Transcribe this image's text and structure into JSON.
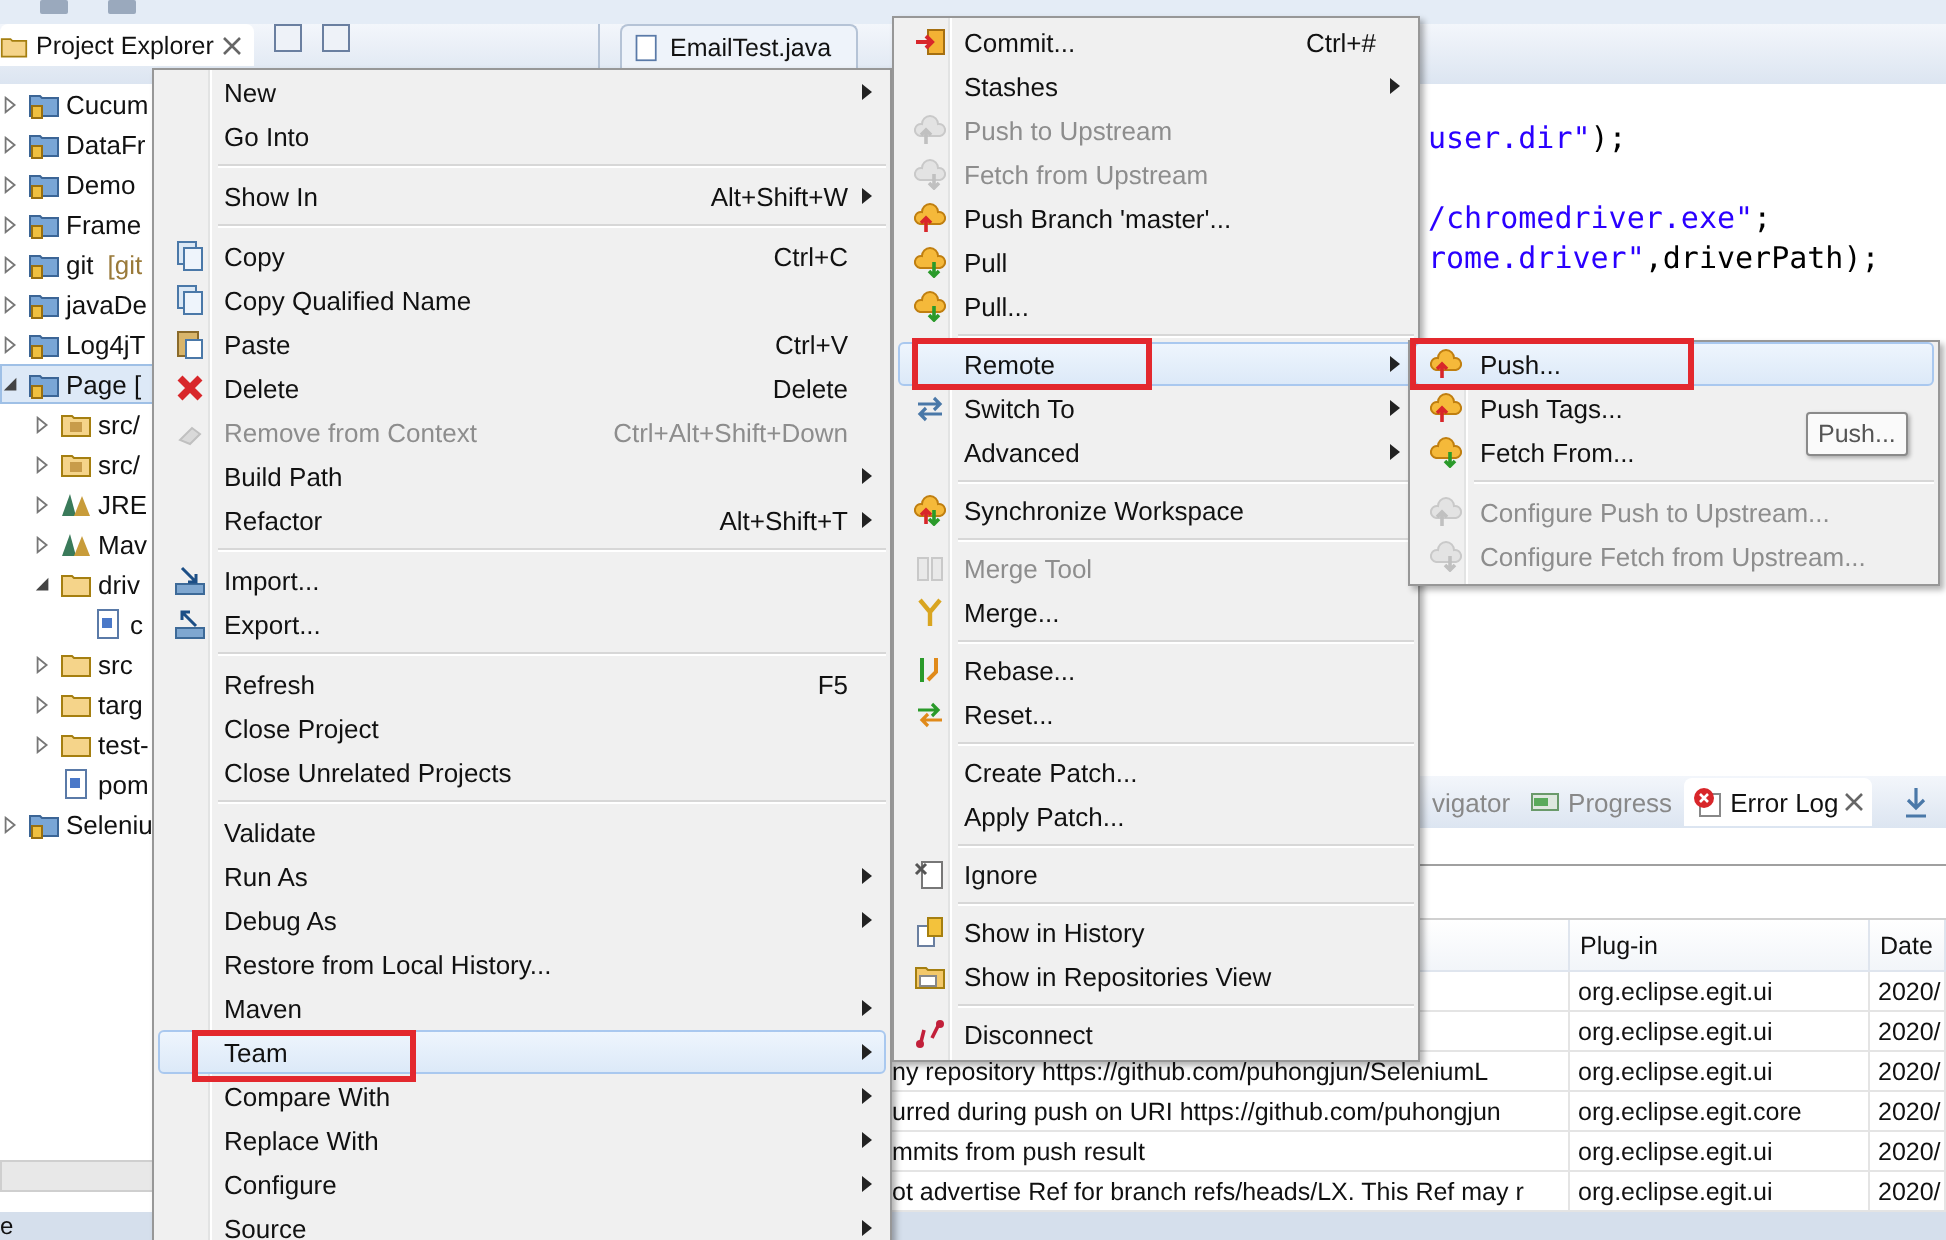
{
  "project_explorer": {
    "title": "Project Explorer",
    "tree": [
      {
        "label": "Cucum",
        "kind": "project",
        "expanded": false,
        "selected": false
      },
      {
        "label": "DataFr",
        "kind": "project",
        "expanded": false,
        "selected": false
      },
      {
        "label": "Demo",
        "kind": "project",
        "expanded": false,
        "selected": false
      },
      {
        "label": "Frame",
        "kind": "project",
        "expanded": false,
        "selected": false
      },
      {
        "label": "git",
        "decoration": "[git",
        "kind": "project",
        "expanded": false,
        "selected": false
      },
      {
        "label": "javaDe",
        "kind": "project",
        "expanded": false,
        "selected": false
      },
      {
        "label": "Log4jT",
        "kind": "project",
        "expanded": false,
        "selected": false
      },
      {
        "label": "Page [",
        "kind": "project",
        "expanded": true,
        "selected": true,
        "children": [
          {
            "label": "src/",
            "kind": "package",
            "expanded": false,
            "selected": false
          },
          {
            "label": "src/",
            "kind": "package",
            "expanded": false,
            "selected": false
          },
          {
            "label": "JRE",
            "kind": "library",
            "expanded": false,
            "selected": false
          },
          {
            "label": "Mav",
            "kind": "library",
            "expanded": false,
            "selected": false
          },
          {
            "label": "driv",
            "kind": "folder",
            "expanded": true,
            "selected": false,
            "children": [
              {
                "label": "c",
                "kind": "file",
                "selected": false
              }
            ]
          },
          {
            "label": "src",
            "kind": "folder",
            "expanded": false,
            "selected": false
          },
          {
            "label": "targ",
            "kind": "folder",
            "expanded": false,
            "selected": false
          },
          {
            "label": "test-",
            "kind": "folder",
            "expanded": false,
            "selected": false
          },
          {
            "label": "pom",
            "kind": "file",
            "selected": false
          }
        ]
      },
      {
        "label": "Seleniu",
        "kind": "project",
        "expanded": false,
        "selected": false
      }
    ]
  },
  "editor": {
    "tab": "EmailTest.java",
    "lines": [
      [
        {
          "text": "user.dir\"",
          "kind": "string"
        },
        {
          "text": ");",
          "kind": "plain"
        }
      ],
      [
        {
          "text": "/chromedriver.exe\"",
          "kind": "string"
        },
        {
          "text": ";",
          "kind": "plain"
        }
      ],
      [
        {
          "text": "rome.driver\"",
          "kind": "string"
        },
        {
          "text": ",driverPath);",
          "kind": "plain"
        }
      ]
    ]
  },
  "bottom_panel": {
    "tabs": [
      {
        "label": "vigator",
        "kind": "plain",
        "selected": false
      },
      {
        "label": "Progress",
        "kind": "progress",
        "selected": false
      },
      {
        "label": "Error Log",
        "kind": "error",
        "selected": true
      }
    ],
    "columns": [
      "Plug-in",
      "Date"
    ],
    "rows": [
      {
        "plug_in": "org.eclipse.egit.ui",
        "date": "2020/"
      },
      {
        "plug_in": "org.eclipse.egit.ui",
        "date": "2020/"
      },
      {
        "column_1": "ny repository https://github.com/puhongjun/SeleniumL",
        "plug_in": "org.eclipse.egit.ui",
        "date": "2020/"
      },
      {
        "column_1": "urred during push on URI https://github.com/puhongjun",
        "plug_in": "org.eclipse.egit.core",
        "date": "2020/"
      },
      {
        "column_1": "mmits from push result",
        "plug_in": "org.eclipse.egit.ui",
        "date": "2020/"
      },
      {
        "column_1": "ot advertise Ref for branch refs/heads/LX. This Ref may r",
        "plug_in": "org.eclipse.egit.ui",
        "date": "2020/"
      }
    ]
  },
  "context_menu": {
    "items": [
      {
        "kind": "plain",
        "label": "New",
        "submenu": true,
        "disabled": false,
        "selected": false,
        "highlighted": false
      },
      {
        "kind": "plain",
        "label": "Go Into",
        "submenu": false,
        "disabled": false,
        "selected": false,
        "highlighted": false
      },
      {
        "kind": "separator"
      },
      {
        "kind": "plain",
        "label": "Show In",
        "shortcut": "Alt+Shift+W",
        "submenu": true,
        "disabled": false,
        "selected": false,
        "highlighted": false
      },
      {
        "kind": "separator"
      },
      {
        "kind": "copy",
        "label": "Copy",
        "shortcut": "Ctrl+C",
        "submenu": false,
        "disabled": false,
        "selected": false,
        "highlighted": false
      },
      {
        "kind": "copy",
        "label": "Copy Qualified Name",
        "submenu": false,
        "disabled": false,
        "selected": false,
        "highlighted": false
      },
      {
        "kind": "paste",
        "label": "Paste",
        "shortcut": "Ctrl+V",
        "submenu": false,
        "disabled": false,
        "selected": false,
        "highlighted": false
      },
      {
        "kind": "delete",
        "label": "Delete",
        "shortcut": "Delete",
        "submenu": false,
        "disabled": false,
        "selected": false,
        "highlighted": false
      },
      {
        "kind": "remove",
        "label": "Remove from Context",
        "shortcut": "Ctrl+Alt+Shift+Down",
        "submenu": false,
        "disabled": true,
        "selected": false,
        "highlighted": false
      },
      {
        "kind": "plain",
        "label": "Build Path",
        "submenu": true,
        "disabled": false,
        "selected": false,
        "highlighted": false
      },
      {
        "kind": "plain",
        "label": "Refactor",
        "shortcut": "Alt+Shift+T",
        "submenu": true,
        "disabled": false,
        "selected": false,
        "highlighted": false
      },
      {
        "kind": "separator"
      },
      {
        "kind": "import",
        "label": "Import...",
        "submenu": false,
        "disabled": false,
        "selected": false,
        "highlighted": false
      },
      {
        "kind": "export",
        "label": "Export...",
        "submenu": false,
        "disabled": false,
        "selected": false,
        "highlighted": false
      },
      {
        "kind": "separator"
      },
      {
        "kind": "plain",
        "label": "Refresh",
        "shortcut": "F5",
        "submenu": false,
        "disabled": false,
        "selected": false,
        "highlighted": false
      },
      {
        "kind": "plain",
        "label": "Close Project",
        "submenu": false,
        "disabled": false,
        "selected": false,
        "highlighted": false
      },
      {
        "kind": "plain",
        "label": "Close Unrelated Projects",
        "submenu": false,
        "disabled": false,
        "selected": false,
        "highlighted": false
      },
      {
        "kind": "separator"
      },
      {
        "kind": "plain",
        "label": "Validate",
        "submenu": false,
        "disabled": false,
        "selected": false,
        "highlighted": false
      },
      {
        "kind": "plain",
        "label": "Run As",
        "submenu": true,
        "disabled": false,
        "selected": false,
        "highlighted": false
      },
      {
        "kind": "plain",
        "label": "Debug As",
        "submenu": true,
        "disabled": false,
        "selected": false,
        "highlighted": false
      },
      {
        "kind": "plain",
        "label": "Restore from Local History...",
        "submenu": false,
        "disabled": false,
        "selected": false,
        "highlighted": false
      },
      {
        "kind": "plain",
        "label": "Maven",
        "submenu": true,
        "disabled": false,
        "selected": false,
        "highlighted": false
      },
      {
        "kind": "plain",
        "label": "Team",
        "submenu": true,
        "disabled": false,
        "selected": true,
        "highlighted": true
      },
      {
        "kind": "plain",
        "label": "Compare With",
        "submenu": true,
        "disabled": false,
        "selected": false,
        "highlighted": false
      },
      {
        "kind": "plain",
        "label": "Replace With",
        "submenu": true,
        "disabled": false,
        "selected": false,
        "highlighted": false
      },
      {
        "kind": "plain",
        "label": "Configure",
        "submenu": true,
        "disabled": false,
        "selected": false,
        "highlighted": false
      },
      {
        "kind": "plain",
        "label": "Source",
        "submenu": true,
        "disabled": false,
        "selected": false,
        "highlighted": false
      }
    ]
  },
  "team_menu": {
    "items": [
      {
        "kind": "commit",
        "label": "Commit...",
        "shortcut": "Ctrl+#",
        "submenu": false,
        "disabled": false,
        "selected": false,
        "highlighted": false
      },
      {
        "kind": "plain",
        "label": "Stashes",
        "submenu": true,
        "disabled": false,
        "selected": false,
        "highlighted": false
      },
      {
        "kind": "cloud-up",
        "label": "Push to Upstream",
        "submenu": false,
        "disabled": true,
        "selected": false,
        "highlighted": false
      },
      {
        "kind": "cloud-down",
        "label": "Fetch from Upstream",
        "submenu": false,
        "disabled": true,
        "selected": false,
        "highlighted": false
      },
      {
        "kind": "cloud-up",
        "label": "Push Branch 'master'...",
        "submenu": false,
        "disabled": false,
        "selected": false,
        "highlighted": false
      },
      {
        "kind": "cloud-down",
        "label": "Pull",
        "submenu": false,
        "disabled": false,
        "selected": false,
        "highlighted": false
      },
      {
        "kind": "cloud-down",
        "label": "Pull...",
        "submenu": false,
        "disabled": false,
        "selected": false,
        "highlighted": false
      },
      {
        "kind": "separator"
      },
      {
        "kind": "plain",
        "label": "Remote",
        "submenu": true,
        "disabled": false,
        "selected": true,
        "highlighted": true
      },
      {
        "kind": "switch",
        "label": "Switch To",
        "submenu": true,
        "disabled": false,
        "selected": false,
        "highlighted": false
      },
      {
        "kind": "plain",
        "label": "Advanced",
        "submenu": true,
        "disabled": false,
        "selected": false,
        "highlighted": false
      },
      {
        "kind": "separator"
      },
      {
        "kind": "cloud-sync",
        "label": "Synchronize Workspace",
        "submenu": false,
        "disabled": false,
        "selected": false,
        "highlighted": false
      },
      {
        "kind": "separator"
      },
      {
        "kind": "merge-tool",
        "label": "Merge Tool",
        "submenu": false,
        "disabled": true,
        "selected": false,
        "highlighted": false
      },
      {
        "kind": "merge",
        "label": "Merge...",
        "submenu": false,
        "disabled": false,
        "selected": false,
        "highlighted": false
      },
      {
        "kind": "separator"
      },
      {
        "kind": "rebase",
        "label": "Rebase...",
        "submenu": false,
        "disabled": false,
        "selected": false,
        "highlighted": false
      },
      {
        "kind": "reset",
        "label": "Reset...",
        "submenu": false,
        "disabled": false,
        "selected": false,
        "highlighted": false
      },
      {
        "kind": "separator"
      },
      {
        "kind": "plain",
        "label": "Create Patch...",
        "submenu": false,
        "disabled": false,
        "selected": false,
        "highlighted": false
      },
      {
        "kind": "plain",
        "label": "Apply Patch...",
        "submenu": false,
        "disabled": false,
        "selected": false,
        "highlighted": false
      },
      {
        "kind": "separator"
      },
      {
        "kind": "ignore",
        "label": "Ignore",
        "submenu": false,
        "disabled": false,
        "selected": false,
        "highlighted": false
      },
      {
        "kind": "separator"
      },
      {
        "kind": "history",
        "label": "Show in History",
        "submenu": false,
        "disabled": false,
        "selected": false,
        "highlighted": false
      },
      {
        "kind": "repo",
        "label": "Show in Repositories View",
        "submenu": false,
        "disabled": false,
        "selected": false,
        "highlighted": false
      },
      {
        "kind": "separator"
      },
      {
        "kind": "disconnect",
        "label": "Disconnect",
        "submenu": false,
        "disabled": false,
        "selected": false,
        "highlighted": false
      }
    ]
  },
  "remote_menu": {
    "items": [
      {
        "kind": "cloud-up",
        "label": "Push...",
        "submenu": false,
        "disabled": false,
        "selected": true,
        "highlighted": true
      },
      {
        "kind": "cloud-up",
        "label": "Push Tags...",
        "submenu": false,
        "disabled": false,
        "selected": false,
        "highlighted": false
      },
      {
        "kind": "cloud-down",
        "label": "Fetch From...",
        "submenu": false,
        "disabled": false,
        "selected": false,
        "highlighted": false
      },
      {
        "kind": "separator"
      },
      {
        "kind": "cloud-up",
        "label": "Configure Push to Upstream...",
        "submenu": false,
        "disabled": true,
        "selected": false,
        "highlighted": false
      },
      {
        "kind": "cloud-down",
        "label": "Configure Fetch from Upstream...",
        "submenu": false,
        "disabled": true,
        "selected": false,
        "highlighted": false
      }
    ]
  },
  "tooltip": "Push...",
  "status_bar": "e"
}
